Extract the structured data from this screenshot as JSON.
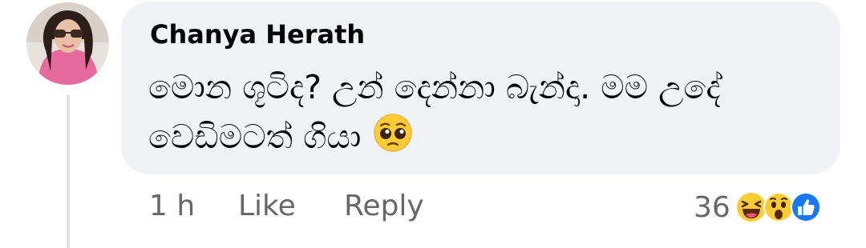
{
  "comment": {
    "author": "Chanya Herath",
    "text": "මොන ශූටිද? උන් දෙන්නා බැන්දා. මම උදේ වෙඩිමටත් ගියා",
    "text_emoji": "pleading-face",
    "time": "1 h",
    "like_label": "Like",
    "reply_label": "Reply",
    "reaction_count": "36",
    "reactions": [
      "laughing-face",
      "surprised-face",
      "thumbs-up"
    ]
  },
  "colors": {
    "bubble": "#f0f2f5",
    "meta_text": "#65676b",
    "like_blue": "#1877f2",
    "emoji_yellow": "#ffcc33"
  }
}
